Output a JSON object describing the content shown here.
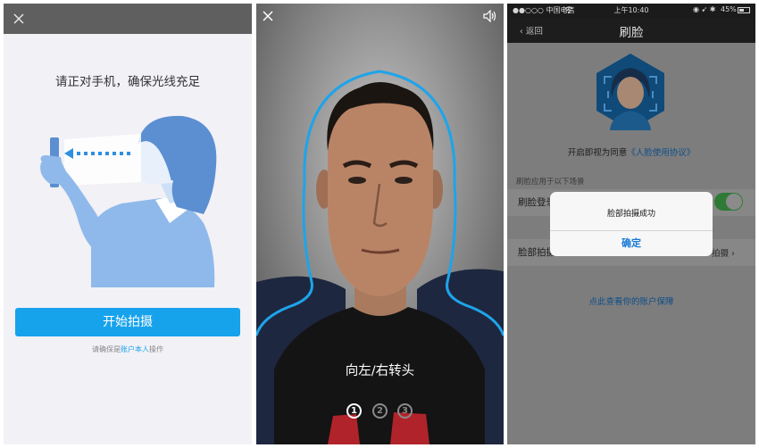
{
  "panel1": {
    "instruction": "请正对手机，确保光线充足",
    "start_button": "开始拍摄",
    "note_prefix": "请确保是",
    "note_link": "账户本人",
    "note_suffix": "操作",
    "accent_color": "#17a2ec"
  },
  "panel2": {
    "prompt": "向左/右转头",
    "steps": [
      "1",
      "2",
      "3"
    ],
    "active_step": 1
  },
  "panel3": {
    "status": {
      "carrier": "●●○○○ 中国电信",
      "time": "上午10:40",
      "battery": "45%"
    },
    "nav": {
      "back_label": "返回",
      "title": "刷脸"
    },
    "agree_prefix": "开启即视为同意",
    "agree_link": "《人脸使用协议》",
    "section_title": "刷脸应用于以下场景",
    "row1_label": "刷脸登录",
    "row2_label": "脸部拍摄",
    "row2_right": "拍摄",
    "bottom_link": "点此查看你的账户保障",
    "dialog": {
      "message": "脸部拍摄成功",
      "confirm": "确定"
    }
  }
}
